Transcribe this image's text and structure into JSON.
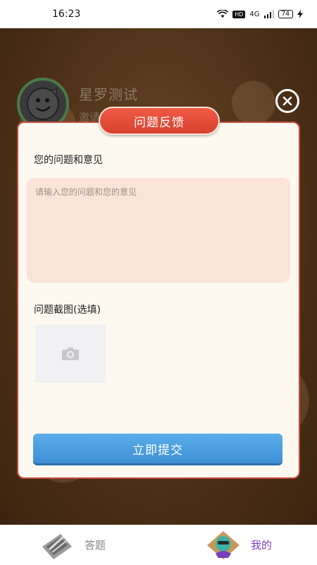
{
  "status_bar": {
    "time": "16:23",
    "hd": "HD",
    "network": "4G",
    "battery": "74"
  },
  "profile": {
    "name": "星罗测试",
    "sub": "邀请码"
  },
  "dialog": {
    "title": "问题反馈",
    "issue_label": "您的问题和意见",
    "issue_placeholder": "请输入您的问题和您的意见",
    "issue_value": "",
    "screenshot_label": "问题截图(选填)",
    "submit_label": "立即提交"
  },
  "bottom_nav": {
    "items": [
      {
        "label": "答题",
        "icon": "quiz-tab-icon",
        "active": false
      },
      {
        "label": "我的",
        "icon": "profile-tab-icon",
        "active": true
      }
    ]
  },
  "colors": {
    "dialog_border": "#c94b3a",
    "header_red": "#e4493a",
    "submit_blue": "#4a9ee0",
    "textarea_bg": "#fbe3d8",
    "active_tab": "#7b3fbf"
  }
}
